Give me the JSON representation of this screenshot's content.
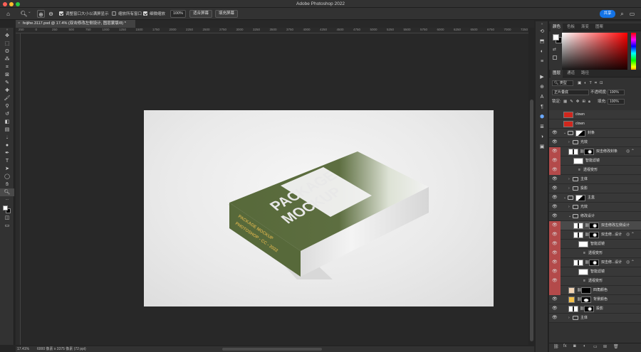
{
  "app": {
    "title": "Adobe Photoshop 2022"
  },
  "colors": {
    "accent": "#1473e6",
    "layer_highlight": "#b34a4a",
    "box_green": "#57693a"
  },
  "options_bar": {
    "home_icon": "home-icon",
    "zoom_icon": "zoom-icon",
    "zoom_in_icon": "zoom-in-icon",
    "zoom_out_icon": "zoom-out-icon",
    "resize_windows_label": "调整窗口大小以满屏显示",
    "resize_windows_checked": true,
    "zoom_all_label": "缩放所有窗口",
    "zoom_all_checked": false,
    "scrubby_label": "细微缩放",
    "scrubby_checked": true,
    "zoom_value": "100%",
    "fit_screen_label": "适合屏幕",
    "fill_screen_label": "填充屏幕",
    "share_label": "共享"
  },
  "document_tab": {
    "title": "feijihe.3117.psd @ 17.4% (双击修改左侧设计, 图层蒙版/8) *",
    "close": "×"
  },
  "ruler_ticks": [
    "250",
    "0",
    "250",
    "500",
    "750",
    "1000",
    "1250",
    "1500",
    "1750",
    "2000",
    "2250",
    "2500",
    "2750",
    "3000",
    "3250",
    "3500",
    "3750",
    "4000",
    "4250",
    "4500",
    "4750",
    "5000",
    "5250",
    "5500",
    "5750",
    "6000",
    "6250",
    "6500",
    "6750",
    "7000",
    "7250"
  ],
  "status_bar": {
    "zoom": "17.41%",
    "doc_info": "6000 像素 x 3375 像素 (72 ppi)"
  },
  "mockup": {
    "line1": "PACKAGE",
    "line2": "MOCKUP",
    "side_line1": "PACKAGE MOCKUP",
    "side_line2": "PHOTOSHOP - CC - 2022"
  },
  "color_panel": {
    "tabs": [
      "颜色",
      "色板",
      "渐变",
      "图案"
    ],
    "active_tab": 0,
    "foreground": "#ffffff",
    "background": "#000000"
  },
  "layers_panel": {
    "tabs": [
      "图层",
      "通道",
      "路径"
    ],
    "active_tab": 0,
    "filter_label": "类型",
    "blend_mode": "正片叠底",
    "opacity_label": "不透明度:",
    "opacity_value": "100%",
    "lock_label": "锁定:",
    "fill_label": "填充:",
    "fill_value": "100%",
    "layers": [
      {
        "name": "clown",
        "type": "red-thumb",
        "indent": 0,
        "visible": false,
        "color": ""
      },
      {
        "name": "clown",
        "type": "red-thumb",
        "indent": 0,
        "visible": false,
        "color": ""
      },
      {
        "name": "封条",
        "type": "group-mask",
        "indent": 0,
        "visible": true,
        "expanded": true,
        "color": ""
      },
      {
        "name": "光效",
        "type": "group",
        "indent": 1,
        "visible": true,
        "color": ""
      },
      {
        "name": "双击修改封条",
        "type": "smart-mask",
        "indent": 1,
        "visible": true,
        "color": "red",
        "fx": true
      },
      {
        "name": "智能滤镜",
        "type": "filter",
        "indent": 2,
        "visible": true,
        "color": "red"
      },
      {
        "name": "透视变形",
        "type": "sub",
        "indent": 3,
        "visible": true,
        "color": "red"
      },
      {
        "name": "主体",
        "type": "group",
        "indent": 1,
        "visible": true,
        "color": ""
      },
      {
        "name": "投影",
        "type": "group",
        "indent": 1,
        "visible": true,
        "color": ""
      },
      {
        "name": "主盒",
        "type": "group-mask",
        "indent": 0,
        "visible": true,
        "expanded": true,
        "color": ""
      },
      {
        "name": "光效",
        "type": "group",
        "indent": 1,
        "visible": true,
        "color": ""
      },
      {
        "name": "修改设计",
        "type": "group-open",
        "indent": 1,
        "visible": true,
        "color": ""
      },
      {
        "name": "双击修改左侧设计",
        "type": "smart-mask",
        "indent": 2,
        "visible": true,
        "color": "red",
        "selected": true
      },
      {
        "name": "双击修...设计",
        "type": "smart-mask",
        "indent": 2,
        "visible": true,
        "color": "red",
        "fx": true
      },
      {
        "name": "智能滤镜",
        "type": "filter",
        "indent": 3,
        "visible": true,
        "color": "red"
      },
      {
        "name": "透视变形",
        "type": "sub",
        "indent": 4,
        "visible": true,
        "color": "red"
      },
      {
        "name": "双击修...设计",
        "type": "smart-mask",
        "indent": 2,
        "visible": true,
        "color": "red",
        "fx": true
      },
      {
        "name": "智能滤镜",
        "type": "filter",
        "indent": 3,
        "visible": true,
        "color": "red"
      },
      {
        "name": "透视变形",
        "type": "sub",
        "indent": 4,
        "visible": true,
        "color": "red"
      },
      {
        "name": "四角颜色",
        "type": "color-fill",
        "indent": 1,
        "visible": false,
        "color": "red"
      },
      {
        "name": "背景颜色",
        "type": "color-fill-y",
        "indent": 1,
        "visible": true,
        "color": ""
      },
      {
        "name": "投影",
        "type": "smart-mask",
        "indent": 1,
        "visible": true,
        "color": ""
      },
      {
        "name": "主体",
        "type": "group",
        "indent": 1,
        "visible": true,
        "color": ""
      }
    ]
  }
}
